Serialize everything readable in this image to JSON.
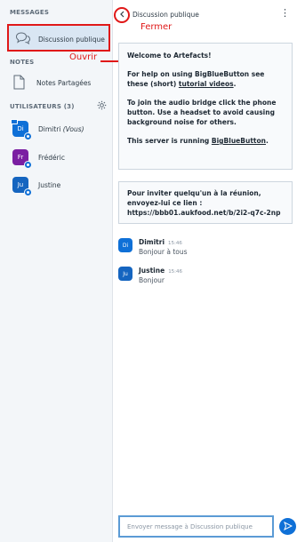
{
  "sidebar": {
    "messages_title": "MESSAGES",
    "public_chat_label": "Discussion publique",
    "notes_title": "NOTES",
    "shared_notes_label": "Notes Partagées",
    "users_title": "UTILISATEURS (3)",
    "users": [
      {
        "initials": "Di",
        "name": "Dimitri",
        "suffix": "(Vous)",
        "color": "#0f70d7"
      },
      {
        "initials": "Fr",
        "name": "Frédéric",
        "suffix": "",
        "color": "#7b1fa2"
      },
      {
        "initials": "Ju",
        "name": "Justine",
        "suffix": "",
        "color": "#1565c0"
      }
    ]
  },
  "annotations": {
    "open": "Ouvrir",
    "close": "Fermer"
  },
  "chat": {
    "title": "Discussion publique",
    "welcome": {
      "line1_prefix": "Welcome to ",
      "line1_bold": "Artefacts",
      "line1_suffix": "!",
      "line2_prefix": "For help on using BigBlueButton see these (short) ",
      "line2_link": "tutorial videos",
      "line2_suffix": ".",
      "line3": "To join the audio bridge click the phone button. Use a headset to avoid causing background noise for others.",
      "line4_prefix": "This server is running ",
      "line4_link": "BigBlueButton",
      "line4_suffix": "."
    },
    "invite": "Pour inviter quelqu'un à la réunion, envoyez-lui ce lien : https://bbb01.aukfood.net/b/2i2-q7c-2np",
    "messages": [
      {
        "initials": "Di",
        "name": "Dimitri",
        "time": "15:46",
        "text": "Bonjour à tous",
        "color": "#0f70d7"
      },
      {
        "initials": "Ju",
        "name": "Justine",
        "time": "15:46",
        "text": "Bonjour",
        "color": "#1565c0"
      }
    ],
    "input_placeholder": "Envoyer message à Discussion publique"
  },
  "colors": {
    "accent": "#0f70d7",
    "annotation": "#e01818"
  }
}
